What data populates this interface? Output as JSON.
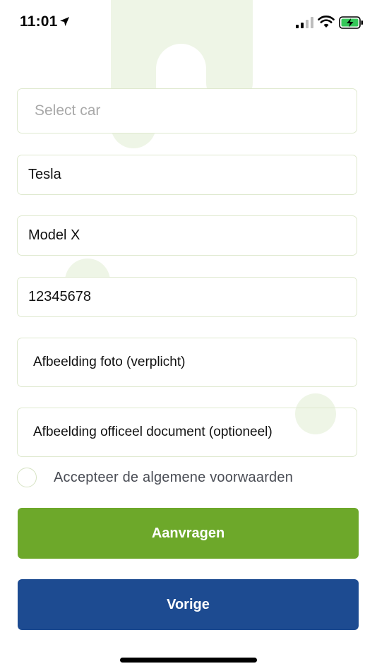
{
  "status_bar": {
    "time": "11:01",
    "icons": [
      "location-arrow-icon",
      "cellular-signal-icon",
      "wifi-icon",
      "battery-charging-icon"
    ]
  },
  "form": {
    "select_car": {
      "value": "",
      "placeholder": "Select car"
    },
    "brand": {
      "value": "Tesla",
      "placeholder": ""
    },
    "model": {
      "value": "Model X",
      "placeholder": ""
    },
    "license_plate": {
      "value": "12345678",
      "placeholder": ""
    },
    "photo_upload_label": "Afbeelding foto (verplicht)",
    "document_upload_label": "Afbeelding officeel document (optioneel)",
    "terms_label": "Accepteer de algemene voorwaarden",
    "terms_checked": false
  },
  "buttons": {
    "submit_label": "Aanvragen",
    "back_label": "Vorige"
  },
  "colors": {
    "submit_button": "#6da82a",
    "back_button": "#1d4b91",
    "field_border": "#dfe9cf",
    "background_accent": "#eef5e6"
  }
}
